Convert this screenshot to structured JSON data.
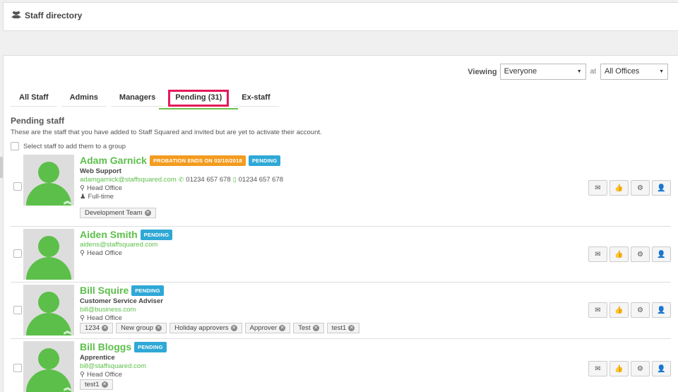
{
  "page": {
    "title": "Staff directory",
    "icon": "users-icon"
  },
  "filters": {
    "viewing_label": "Viewing",
    "viewing_value": "Everyone",
    "at_label": "at",
    "office_value": "All Offices"
  },
  "tabs": [
    {
      "label": "All Staff"
    },
    {
      "label": "Admins"
    },
    {
      "label": "Managers"
    },
    {
      "label": "Pending (31)",
      "active": true
    },
    {
      "label": "Ex-staff"
    }
  ],
  "section": {
    "title": "Pending staff",
    "description": "These are the staff that you have added to Staff Squared and invited but are yet to activate their account.",
    "select_all_label": "Select staff to add them to a group"
  },
  "staff": [
    {
      "name": "Adam Garnick",
      "badges": [
        {
          "text": "PROBATION ENDS ON 02/10/2018",
          "color": "#f39c1f"
        },
        {
          "text": "PENDING",
          "color": "#2fa8d6"
        }
      ],
      "job": "Web Support",
      "email": "adamgarnick@staffsquared.com",
      "phone": "01234 657 678",
      "mobile": "01234 657 678",
      "office": "Head Office",
      "employment": "Full-time",
      "tags": [
        "Development Team"
      ]
    },
    {
      "name": "Aiden Smith",
      "badges": [
        {
          "text": "PENDING",
          "color": "#2fa8d6"
        }
      ],
      "email": "aidens@staffsquared.com",
      "office": "Head Office",
      "tags": []
    },
    {
      "name": "Bill Squire",
      "badges": [
        {
          "text": "PENDING",
          "color": "#2fa8d6"
        }
      ],
      "job": "Customer Service Adviser",
      "email": "bill@business.com",
      "office": "Head Office",
      "tags": [
        "1234",
        "New group",
        "Holiday approvers",
        "Approver",
        "Test",
        "test1"
      ]
    },
    {
      "name": "Bill Bloggs",
      "badges": [
        {
          "text": "PENDING",
          "color": "#2fa8d6"
        }
      ],
      "job": "Apprentice",
      "email": "bill@staffsquared.com",
      "office": "Head Office",
      "tags": [
        "test1"
      ]
    }
  ],
  "actions": {
    "message_icon": "envelope-icon",
    "endorse_icon": "thumbs-up-icon",
    "settings_icon": "gear-icon",
    "profile_icon": "user-icon"
  },
  "colors": {
    "accent": "#5cbf4a",
    "highlight": "#e6195a",
    "pending": "#2fa8d6",
    "probation": "#f39c1f"
  }
}
